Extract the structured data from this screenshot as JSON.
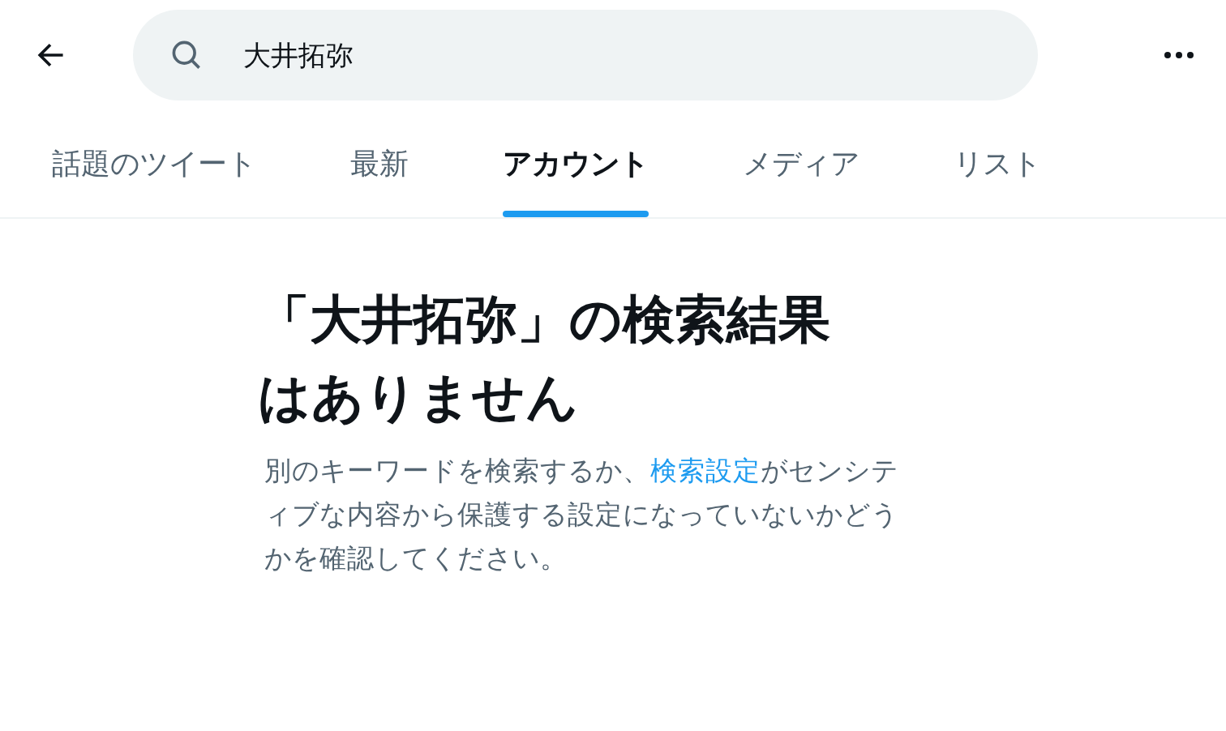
{
  "search": {
    "value": "大井拓弥"
  },
  "tabs": [
    {
      "label": "話題のツイート",
      "selected": false
    },
    {
      "label": "最新",
      "selected": false
    },
    {
      "label": "アカウント",
      "selected": true
    },
    {
      "label": "メディア",
      "selected": false
    },
    {
      "label": "リスト",
      "selected": false
    }
  ],
  "empty_state": {
    "heading": "「大井拓弥」の検索結果はありません",
    "message_before": "別のキーワードを検索するか、",
    "message_link": "検索設定",
    "message_after": "がセンシティブな内容から保護する設定になっていないかどうかを確認してください。"
  }
}
